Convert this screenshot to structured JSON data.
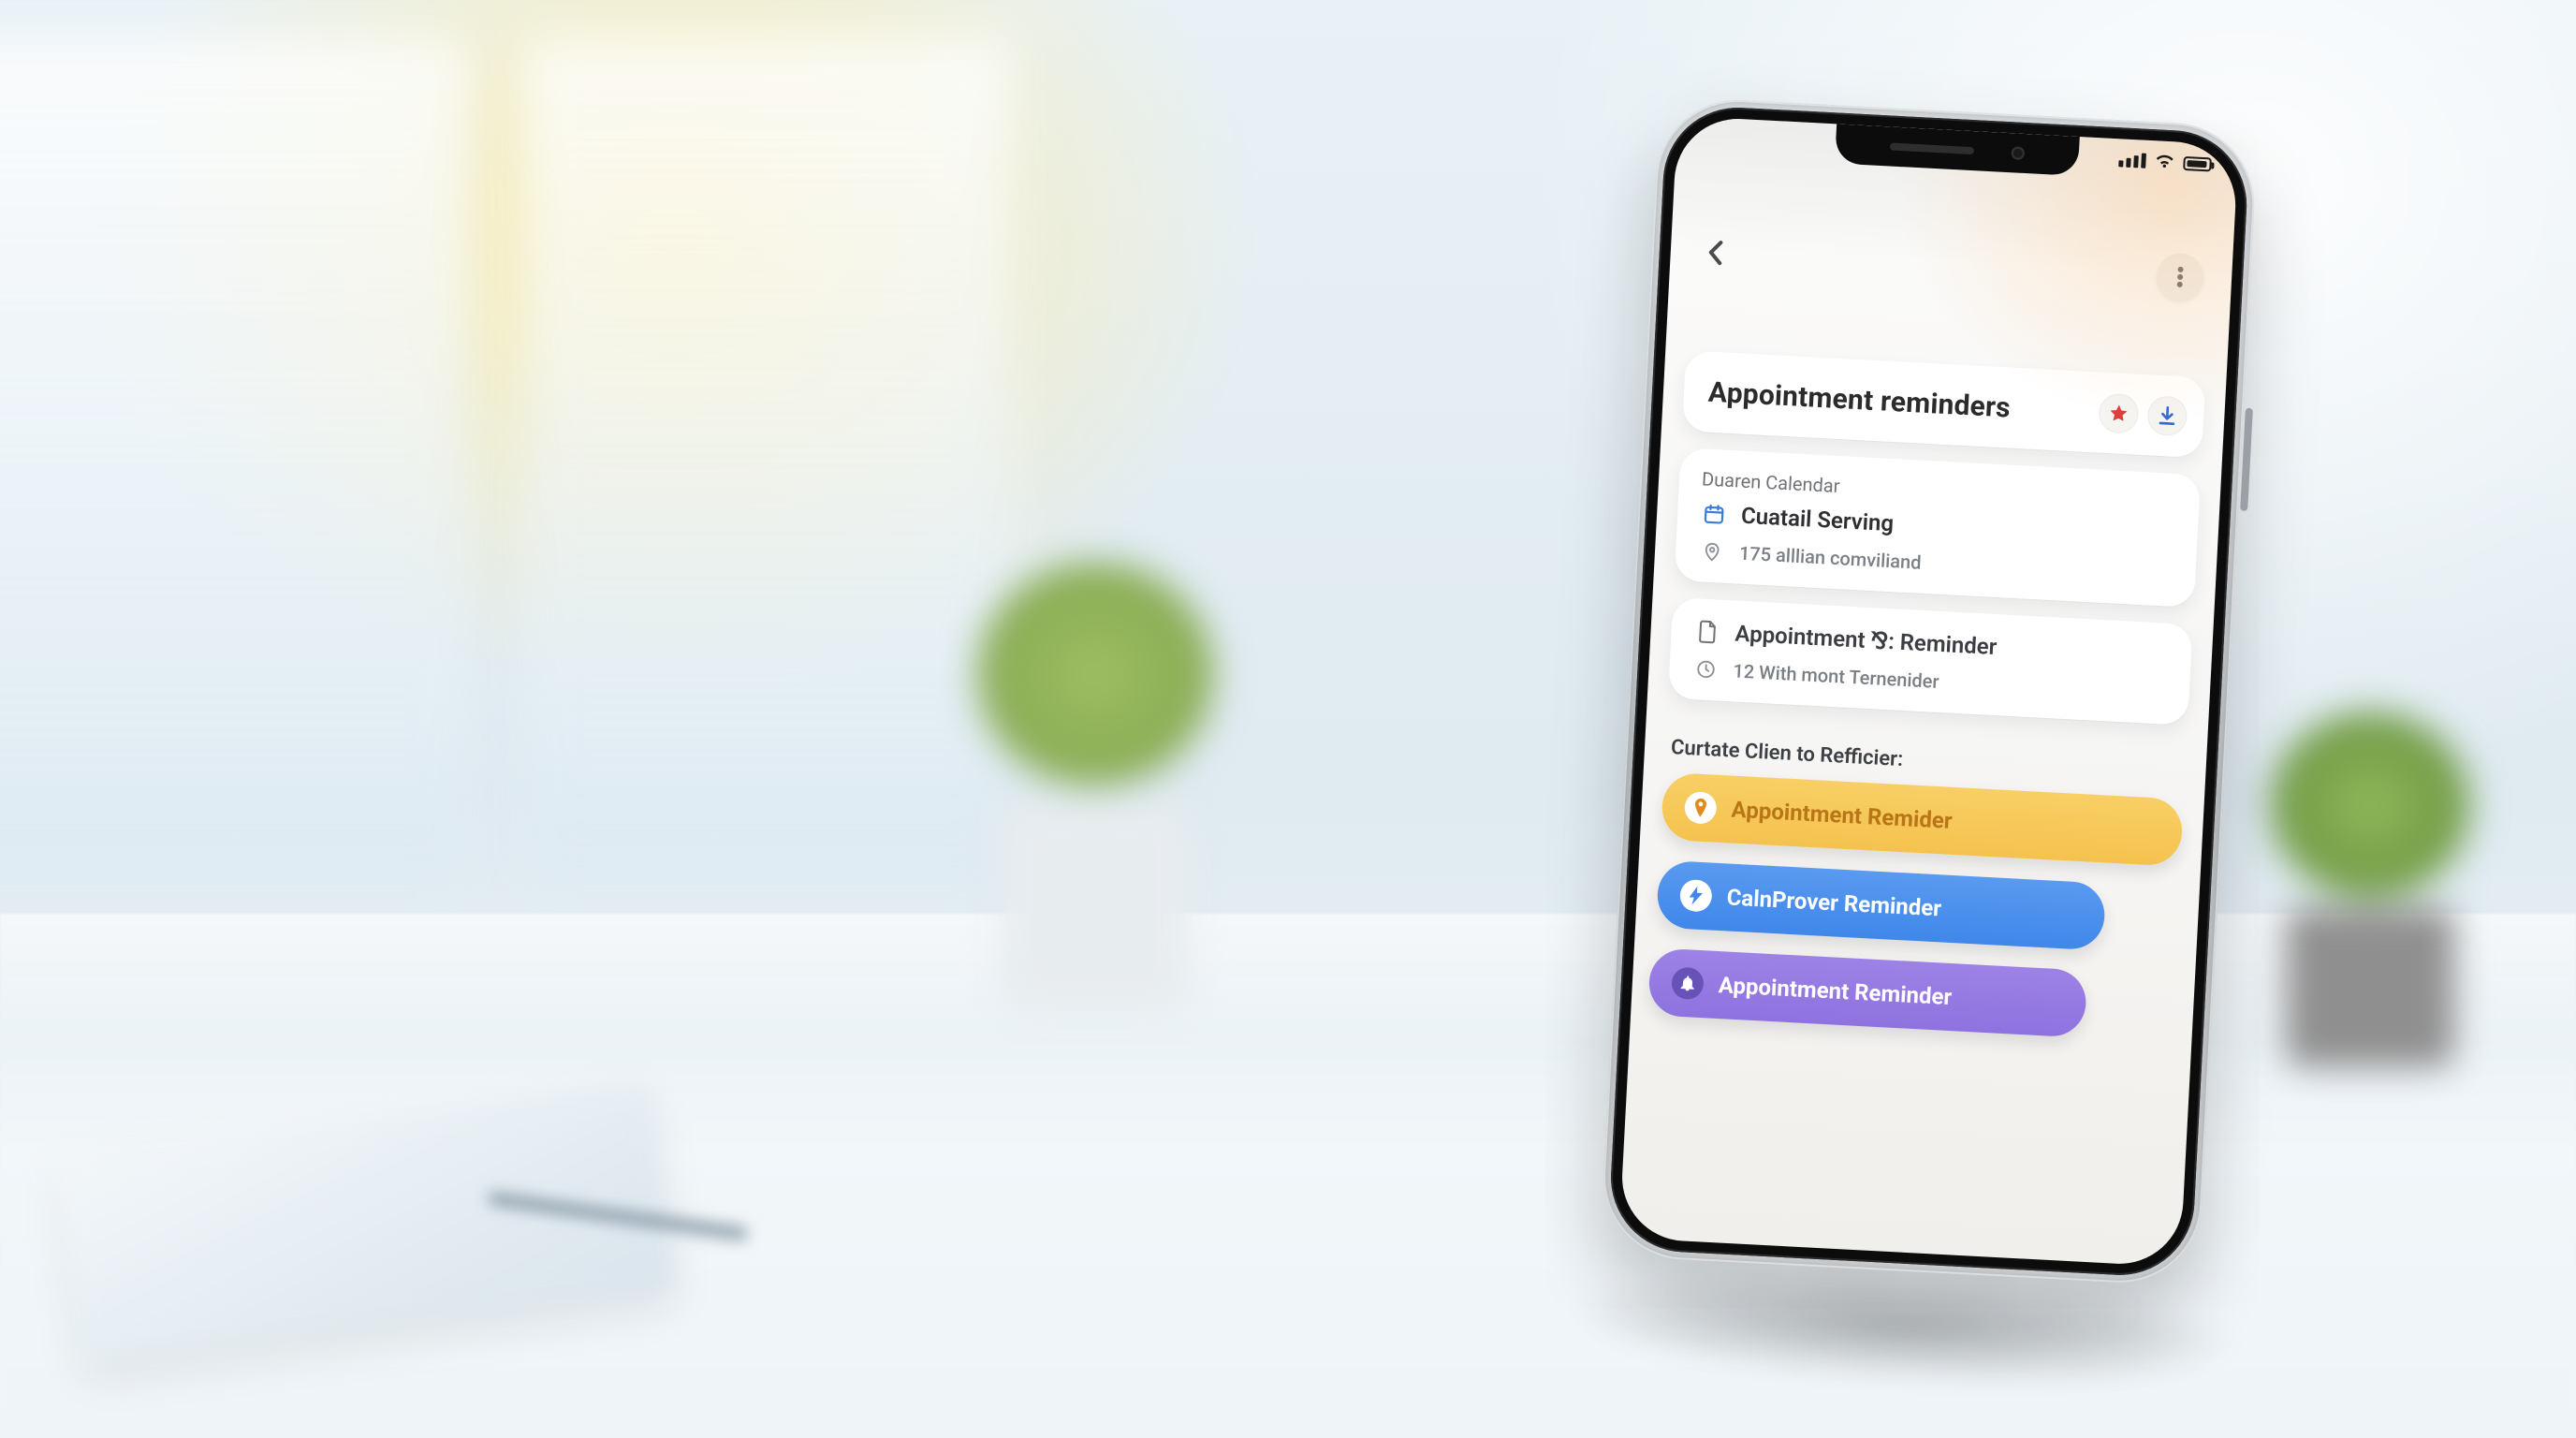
{
  "header": {
    "title": "Appointment reminders"
  },
  "calendar_card": {
    "label": "Duaren Calendar",
    "row1": "Cuatail Serving",
    "row2": "175 alllian comviliand"
  },
  "appt_card": {
    "row1": "Appointment ⅋: Reminder",
    "row2": "12 With mont Ternenider"
  },
  "section_label": "Curtate Clien to Refficier:",
  "pills": {
    "gold": "Appointment Remider",
    "blue": "CalnProver Reminder",
    "purple": "Appointment Reminder"
  }
}
